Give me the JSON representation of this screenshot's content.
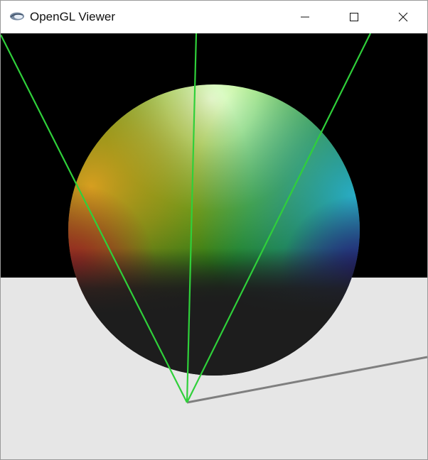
{
  "window": {
    "title": "OpenGL Viewer",
    "icon": "opengl-app-icon",
    "controls": {
      "minimize_icon": "minimize-icon",
      "maximize_icon": "maximize-icon",
      "close_icon": "close-icon"
    }
  },
  "scene": {
    "background_color": "#000000",
    "floor_color": "#e6e6e6",
    "frustum_line_color": "#2fd03a",
    "axis_line_color": "#7f7f7f",
    "sphere_base_color": "#1d1d1d"
  }
}
